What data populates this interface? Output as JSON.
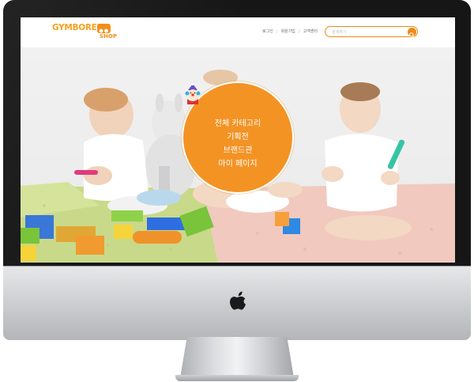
{
  "header": {
    "logo": {
      "brand": "GYMBOREE",
      "sub": "SHOP"
    },
    "nav": [
      {
        "label": "로그인"
      },
      {
        "label": "회원가입"
      },
      {
        "label": "고객센터"
      }
    ],
    "search": {
      "placeholder": "검색하기",
      "icon": "search-icon"
    }
  },
  "hero": {
    "menu": [
      {
        "label": "전체 카테고리"
      },
      {
        "label": "기획전"
      },
      {
        "label": "브랜드관"
      },
      {
        "label": "마이 페이지"
      }
    ],
    "mascot_icon": "clown-mascot-icon"
  },
  "colors": {
    "accent": "#f39324",
    "logo": "#f5a11d",
    "monitor_bezel": "#161616"
  }
}
